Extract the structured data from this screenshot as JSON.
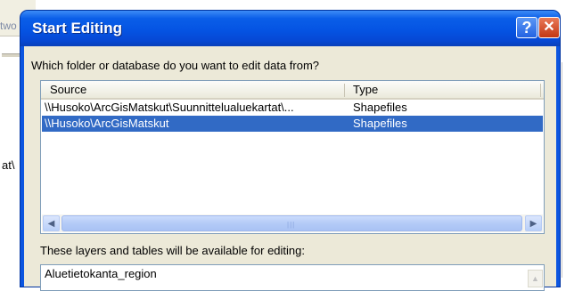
{
  "background": {
    "fragment_top": "two",
    "fragment_mid": "at\\"
  },
  "dialog": {
    "title": "Start Editing",
    "help_glyph": "?",
    "close_glyph": "✕",
    "prompt": "Which folder or database do you want to edit data from?",
    "columns": {
      "source": "Source",
      "type": "Type"
    },
    "rows": [
      {
        "source": "\\\\Husoko\\ArcGisMatskut\\Suunnittelualuekartat\\...",
        "type": "Shapefiles",
        "selected": false
      },
      {
        "source": "\\\\Husoko\\ArcGisMatskut",
        "type": "Shapefiles",
        "selected": true
      }
    ],
    "scroll_left_glyph": "◀",
    "scroll_right_glyph": "▶",
    "scroll_grip": "|||",
    "layers_label": "These layers and tables will be available for editing:",
    "layers": [
      "Aluetietokanta_region"
    ],
    "scroll_up_glyph": "▲"
  },
  "colors": {
    "title_bar": "#0554e3",
    "selection": "#316ac5",
    "dialog_face": "#ece9d8"
  }
}
